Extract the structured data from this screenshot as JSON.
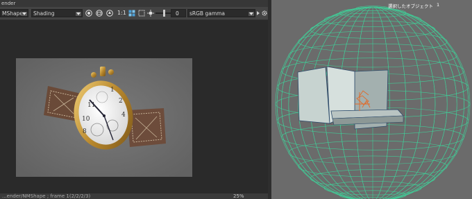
{
  "window": {
    "title": "ender"
  },
  "toolbar": {
    "camera_label": "MShape",
    "display_label": "Shading",
    "ratio_label": "1:1",
    "exposure_value": "0",
    "colorspace_label": "sRGB gamma"
  },
  "status": {
    "text": "...ender/NMShape ; frame 1(2/2/2/3)",
    "zoom": "25%"
  },
  "hud": {
    "label": "選択したオブジェクト",
    "value": "1"
  },
  "colors": {
    "wireframe": "#3fd29a",
    "background": "#6b6b6b",
    "accent": "#e06a2a"
  },
  "icons": [
    "snapshot-icon",
    "render-region-icon",
    "keep-image-icon",
    "exposure-icon",
    "gamma-icon",
    "settings-icon"
  ]
}
